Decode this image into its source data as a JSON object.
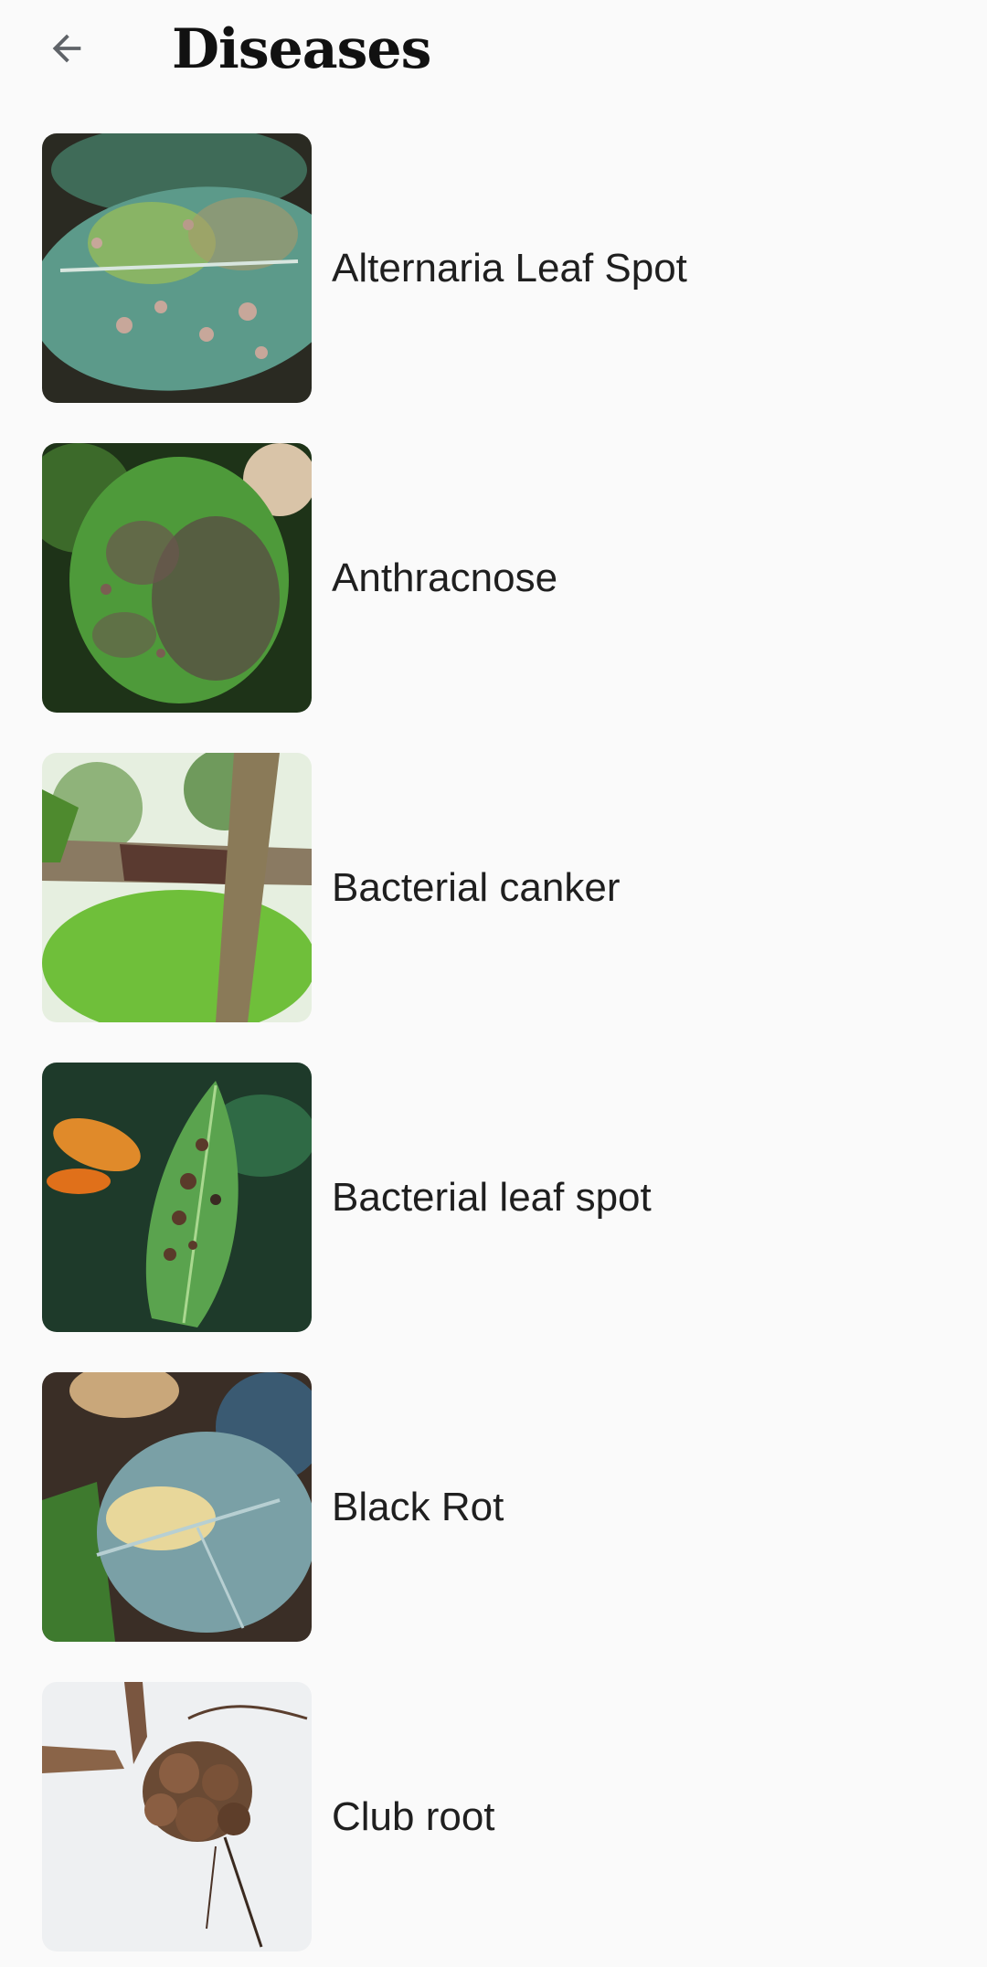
{
  "header": {
    "title": "Diseases",
    "back_icon": "arrow-left-icon"
  },
  "diseases": [
    {
      "name": "Alternaria Leaf Spot"
    },
    {
      "name": "Anthracnose"
    },
    {
      "name": "Bacterial canker"
    },
    {
      "name": "Bacterial leaf spot"
    },
    {
      "name": "Black Rot"
    },
    {
      "name": "Club root"
    }
  ],
  "colors": {
    "background": "#fafafa",
    "text": "#1f1f1f",
    "icon": "#5f6368"
  }
}
